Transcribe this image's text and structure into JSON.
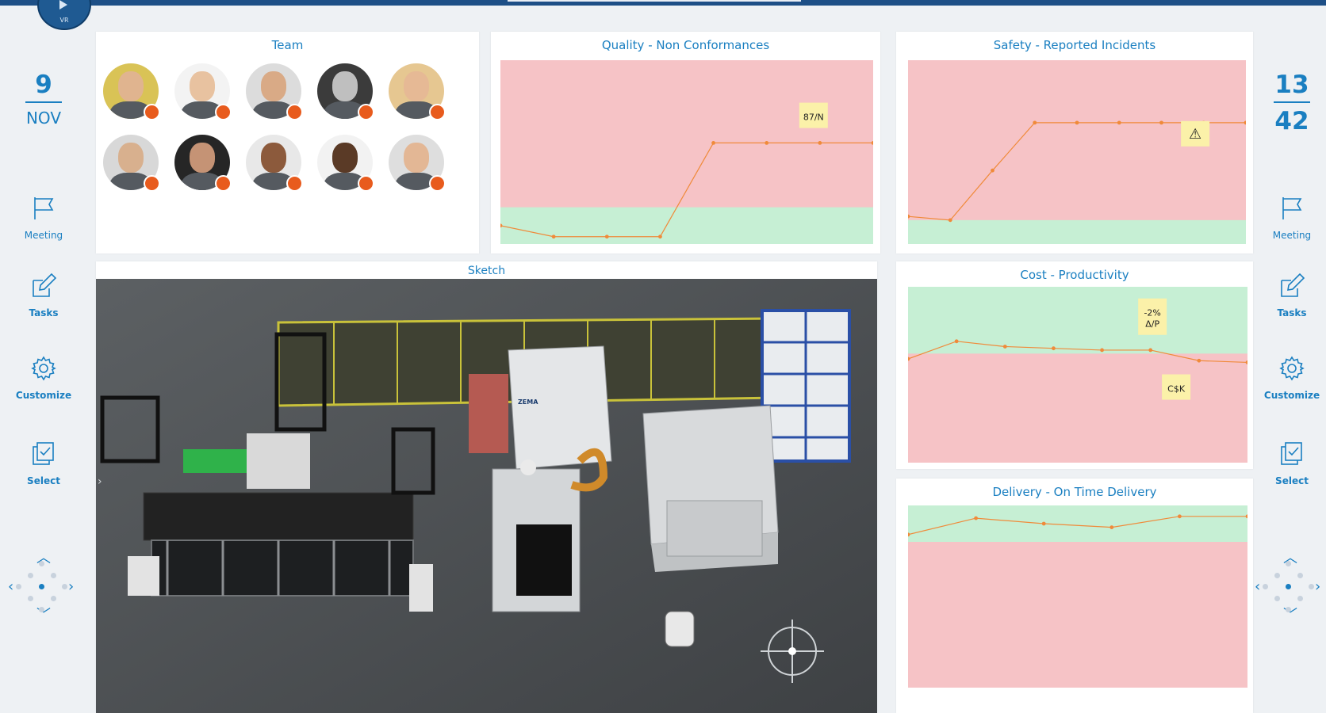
{
  "logo": {
    "text": "VR"
  },
  "left_sidebar": {
    "date_day": "9",
    "date_month": "NOV",
    "items": [
      {
        "label": "Meeting",
        "icon": "flag-icon"
      },
      {
        "label": "Tasks",
        "icon": "edit-icon"
      },
      {
        "label": "Customize",
        "icon": "gear-icon"
      },
      {
        "label": "Select",
        "icon": "checkbox-icon"
      }
    ]
  },
  "right_sidebar": {
    "top_value": "13",
    "bottom_value": "42",
    "items": [
      {
        "label": "Meeting",
        "icon": "flag-icon"
      },
      {
        "label": "Tasks",
        "icon": "edit-icon"
      },
      {
        "label": "Customize",
        "icon": "gear-icon"
      },
      {
        "label": "Select",
        "icon": "checkbox-icon"
      }
    ]
  },
  "team": {
    "title": "Team",
    "members": [
      {
        "status": "#e85b1d",
        "bg": "#d9c356"
      },
      {
        "status": "#e85b1d",
        "bg": "#f3f3f3"
      },
      {
        "status": "#e85b1d",
        "bg": "#dcdcdc"
      },
      {
        "status": "#e85b1d",
        "bg": "#3b3b3b"
      },
      {
        "status": "#e85b1d",
        "bg": "#e6c791"
      },
      {
        "status": "#e85b1d",
        "bg": "#d8d8d8"
      },
      {
        "status": "#e85b1d",
        "bg": "#262626"
      },
      {
        "status": "#e85b1d",
        "bg": "#e8e8e8"
      },
      {
        "status": "#e85b1d",
        "bg": "#f2f2f2"
      },
      {
        "status": "#e85b1d",
        "bg": "#dedede"
      }
    ]
  },
  "sketch": {
    "title": "Sketch",
    "brand_text": "ZEMA"
  },
  "colors": {
    "accent": "#1a7fc1",
    "red_zone": "#f6c3c6",
    "green_zone": "#c6efd4",
    "line": "#f08a3a",
    "note": "#fbf1a9"
  },
  "chart_data": [
    {
      "type": "line",
      "title": "Quality - Non Conformances",
      "x": [
        0,
        1,
        2,
        3,
        4,
        5,
        6,
        7
      ],
      "y": [
        0.1,
        0.04,
        0.04,
        0.04,
        0.55,
        0.55,
        0.55,
        0.55
      ],
      "ylim": [
        0,
        1
      ],
      "green_band": [
        0,
        0.2
      ],
      "annotations": [
        {
          "text": "87/N"
        }
      ]
    },
    {
      "type": "line",
      "title": "Safety - Reported Incidents",
      "x": [
        0,
        1,
        2,
        3,
        4,
        5,
        6,
        7,
        8
      ],
      "y": [
        0.15,
        0.13,
        0.4,
        0.66,
        0.66,
        0.66,
        0.66,
        0.66,
        0.66
      ],
      "ylim": [
        0,
        1
      ],
      "green_band": [
        0,
        0.13
      ],
      "annotations": [
        {
          "text": "⚠"
        }
      ]
    },
    {
      "type": "line",
      "title": "Cost - Productivity",
      "x": [
        0,
        1,
        2,
        3,
        4,
        5,
        6,
        7
      ],
      "y": [
        0.59,
        0.69,
        0.66,
        0.65,
        0.64,
        0.64,
        0.58,
        0.57
      ],
      "ylim": [
        0,
        1
      ],
      "green_band": [
        0.62,
        1
      ],
      "annotations": [
        {
          "text": "-2%\nΔ/P"
        },
        {
          "text": "C$K"
        }
      ]
    },
    {
      "type": "line",
      "title": "Delivery - On Time Delivery",
      "x": [
        0,
        1,
        2,
        3,
        4,
        5
      ],
      "y": [
        0.84,
        0.93,
        0.9,
        0.88,
        0.94,
        0.94
      ],
      "ylim": [
        0,
        1
      ],
      "green_band": [
        0.8,
        1
      ],
      "annotations": []
    }
  ]
}
